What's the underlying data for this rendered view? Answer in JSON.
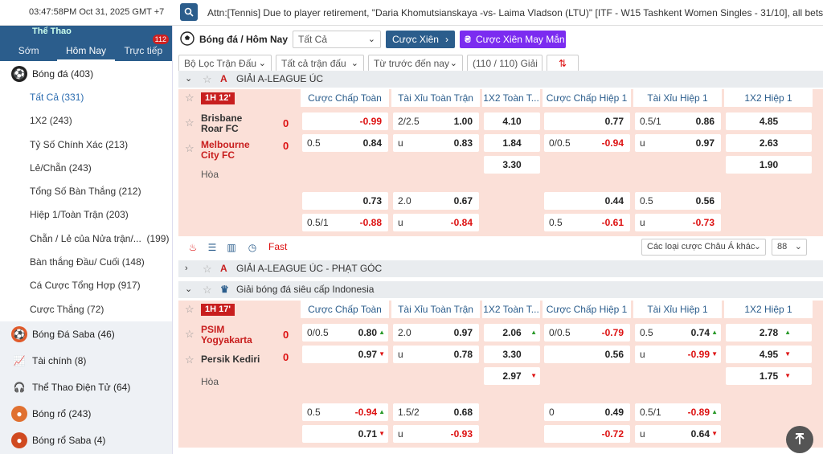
{
  "top": {
    "clock": "03:47:58PM Oct 31, 2025 GMT +7",
    "ticker": "Attn:[Tennis] Due to player retirement, \"Daria Khomutsianskaya -vs- Laima Vladson (LTU)\" [ITF - W15 Tashkent Women Singles - 31/10], all bets taken"
  },
  "sidebar": {
    "header": "Thể Thao",
    "tabs": [
      {
        "label": "Sớm"
      },
      {
        "label": "Hôm Nay"
      },
      {
        "label": "Trực tiếp",
        "badge": "112"
      }
    ],
    "football": {
      "label": "Bóng đá",
      "count": "(403)"
    },
    "subitems": [
      {
        "label": "Tất Cả",
        "count": "(331)"
      },
      {
        "label": "1X2",
        "count": "(243)"
      },
      {
        "label": "Tỷ Số Chính Xác",
        "count": "(213)"
      },
      {
        "label": "Lẻ/Chẵn",
        "count": "(243)"
      },
      {
        "label": "Tổng Số Bàn Thắng",
        "count": "(212)"
      },
      {
        "label": "Hiệp 1/Toàn Trận",
        "count": "(203)"
      },
      {
        "label": "Chẵn / Lẻ của Nửa trận/...",
        "count": "(199)"
      },
      {
        "label": "Bàn thắng Đầu/ Cuối",
        "count": "(148)"
      },
      {
        "label": "Cá Cược Tổng Hợp",
        "count": "(917)"
      },
      {
        "label": "Cược Thắng",
        "count": "(72)"
      }
    ],
    "sports": [
      {
        "label": "Bóng Đá Saba",
        "count": "(46)",
        "icon": "soccer-saba-icon"
      },
      {
        "label": "Tài chính",
        "count": "(8)",
        "icon": "chart-icon"
      },
      {
        "label": "Thể Thao Điện Tử",
        "count": "(64)",
        "icon": "headset-icon"
      },
      {
        "label": "Bóng rổ",
        "count": "(243)",
        "icon": "basketball-icon"
      },
      {
        "label": "Bóng rổ Saba",
        "count": "(4)",
        "icon": "basketball-saba-icon"
      }
    ]
  },
  "toolbar": {
    "title": "Bóng đá / Hôm Nay",
    "filter_all": "Tất Cả",
    "parlay": "Cược Xiên",
    "lucky": "Cược Xiên May Mắn",
    "match_filter": "Bộ Lọc Trận Đấu",
    "all_matches": "Tất cả trận đấu",
    "sort": "Từ trước đến nay",
    "count": "(110 / 110) Giải"
  },
  "columns": [
    "Cược Chấp Toàn T...",
    "Tài Xỉu Toàn Trận",
    "1X2 Toàn T...",
    "Cược Chấp Hiệp 1",
    "Tài Xỉu Hiệp 1",
    "1X2 Hiệp 1"
  ],
  "league1": {
    "name": "GIẢI A-LEAGUE ÚC",
    "logo": "A"
  },
  "match1": {
    "time": "1H 12'",
    "home": "Brisbane Roar FC",
    "away": "Melbourne City FC",
    "home_score": "0",
    "away_score": "0",
    "draw": "Hòa",
    "r1": [
      "",
      "-0.99",
      "2/2.5",
      "1.00",
      "4.10",
      "",
      "0.77",
      "0.5/1",
      "0.86",
      "4.85"
    ],
    "r2": [
      "0.5",
      "0.84",
      "u",
      "0.83",
      "1.84",
      "0/0.5",
      "-0.94",
      "u",
      "0.97",
      "2.63"
    ],
    "r3": [
      "3.30",
      "1.90"
    ],
    "r4": [
      "",
      "0.73",
      "2.0",
      "0.67",
      "",
      "0.44",
      "0.5",
      "0.56"
    ],
    "r5": [
      "0.5/1",
      "-0.88",
      "u",
      "-0.84",
      "0.5",
      "-0.61",
      "u",
      "-0.73"
    ]
  },
  "footer1": {
    "fast": "Fast",
    "other": "Các loại cược Châu Á khác",
    "num": "88"
  },
  "league2": {
    "name": "GIẢI A-LEAGUE ÚC - PHẠT GÓC",
    "logo": "A"
  },
  "league3": {
    "name": "Giải bóng đá siêu cấp Indonesia"
  },
  "match2": {
    "time": "1H 17'",
    "home": "PSIM Yogyakarta",
    "away": "Persik Kediri",
    "home_score": "0",
    "away_score": "0",
    "draw": "Hòa",
    "r1": [
      "0/0.5",
      "0.80",
      "2.0",
      "0.97",
      "2.06",
      "0/0.5",
      "-0.79",
      "0.5",
      "0.74",
      "2.78"
    ],
    "r2": [
      "",
      "0.97",
      "u",
      "0.78",
      "3.30",
      "",
      "0.56",
      "u",
      "-0.99",
      "4.95"
    ],
    "r3": [
      "2.97",
      "1.75"
    ],
    "r4": [
      "0.5",
      "-0.94",
      "1.5/2",
      "0.68",
      "0",
      "0.49",
      "0.5/1",
      "-0.89"
    ],
    "r5": [
      "",
      "0.71",
      "u",
      "-0.93",
      "",
      "-0.72",
      "u",
      "0.64"
    ]
  },
  "colors": {
    "brand": "#2b5d8c",
    "live_row": "#fbe0d8",
    "negative": "#dd1111",
    "lucky": "#7b2cf0"
  }
}
